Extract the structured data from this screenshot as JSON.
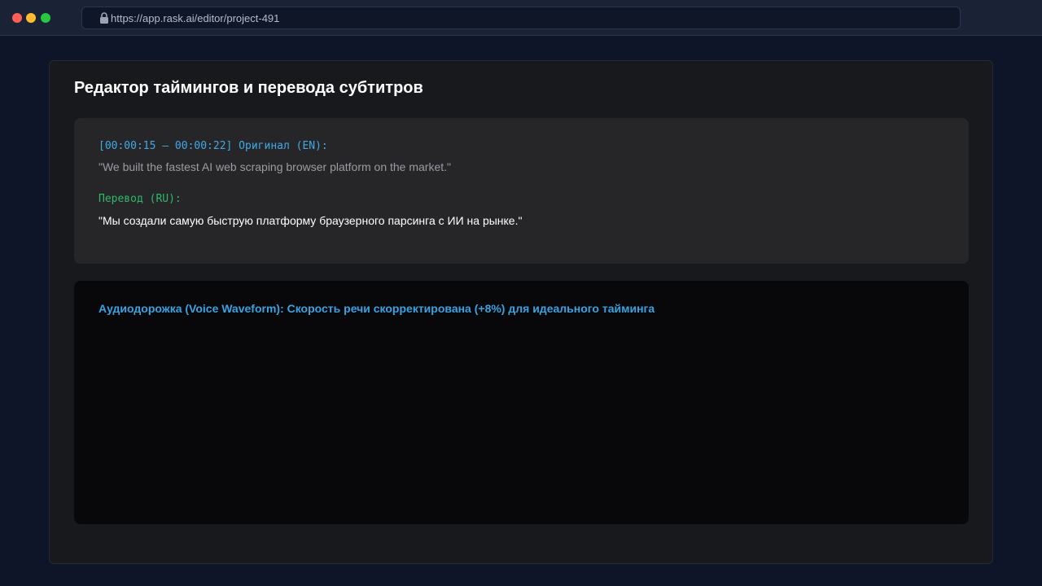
{
  "browser": {
    "url": "https://app.rask.ai/editor/project-491",
    "traffic_lights": {
      "close_color": "#ff5f57",
      "minimize_color": "#febc2e",
      "maximize_color": "#28c840"
    }
  },
  "editor": {
    "title": "Редактор таймингов и перевода субтитров",
    "segment": {
      "original_label": "[00:00:15 – 00:00:22] Оригинал (EN):",
      "original_text": "\"We built the fastest AI web scraping browser platform on the market.\"",
      "translation_label": "Перевод (RU):",
      "translation_text": "\"Мы создали самую быструю платформу браузерного парсинга с ИИ на рынке.\""
    },
    "waveform": {
      "title": "Аудиодорожка (Voice Waveform): Скорость речи скорректирована (+8%) для идеального тайминга"
    }
  },
  "colors": {
    "accent_blue": "#41a9e6",
    "accent_green": "#31b769"
  }
}
